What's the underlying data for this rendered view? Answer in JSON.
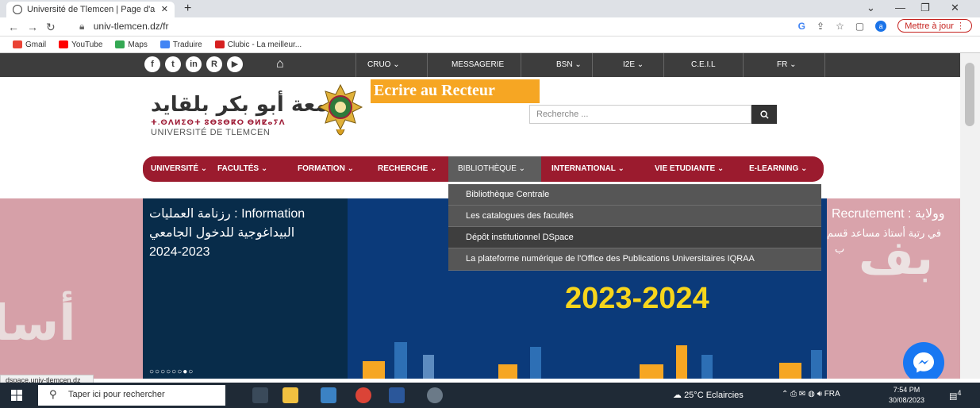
{
  "browser": {
    "tab_title": "Université de Tlemcen | Page d'a",
    "tab_close": "✕",
    "new_tab": "+",
    "url": "univ-tlemcen.dz/fr",
    "update_label": "Mettre à jour",
    "profile_initial": "a",
    "bookmarks": [
      "Gmail",
      "YouTube",
      "Maps",
      "Traduire",
      "Clubic - La meilleur..."
    ],
    "status_url": "dspace.univ-tlemcen.dz"
  },
  "topbar": {
    "links": [
      "CRUO ⌄",
      "MESSAGERIE",
      "BSN ⌄",
      "I2E ⌄",
      "C.E.I.L",
      "FR ⌄"
    ]
  },
  "header": {
    "logo_arabic": "جامعة أبو بكر بلقايد",
    "logo_tifinagh": "ⵜ.ⵙⴷⵍⵉⵙⵜ ⵓⴱⵓⴱⴽⵔ ⴱⵍⵇⴰⵢⴷ",
    "logo_french": "UNIVERSITÉ DE TLEMCEN",
    "recteur_banner": "Ecrire au Recteur",
    "search_placeholder": "Recherche ..."
  },
  "mainnav": {
    "items": [
      "UNIVERSITÉ ⌄",
      "FACULTÉS ⌄",
      "FORMATION ⌄",
      "RECHERCHE ⌄",
      "BIBLIOTHÈQUE ⌄",
      "INTERNATIONAL ⌄",
      "VIE ETUDIANTE ⌄",
      "E-LEARNING ⌄"
    ]
  },
  "dropdown": {
    "items": [
      "Bibliothèque Centrale",
      "Les catalogues des facultés",
      "Dépôt institutionnel DSpace",
      "La plateforme numérique de l'Office des Publications Universitaires IQRAA"
    ]
  },
  "hero": {
    "info_line1": "رزنامة العمليات : Information",
    "info_line2": "البيداغوجية للدخول الجامعي",
    "info_line3": "2024-2023",
    "year": "2023-2024",
    "right_line1": "Recrutement : وولاية",
    "right_line2": "في رتبة أستاذ مساعد قسم",
    "right_line3": "ب",
    "dots": "○○○○○○●○"
  },
  "taskbar": {
    "search": "Taper ici pour rechercher",
    "weather": "25°C  Eclaircies",
    "lang": "FRA",
    "time": "7:54 PM",
    "date": "30/08/2023",
    "notif_count": "4"
  },
  "colors": {
    "nav_red": "#9b1b2e",
    "recteur_orange": "#f6a623",
    "year_yellow": "#f7d51c"
  }
}
